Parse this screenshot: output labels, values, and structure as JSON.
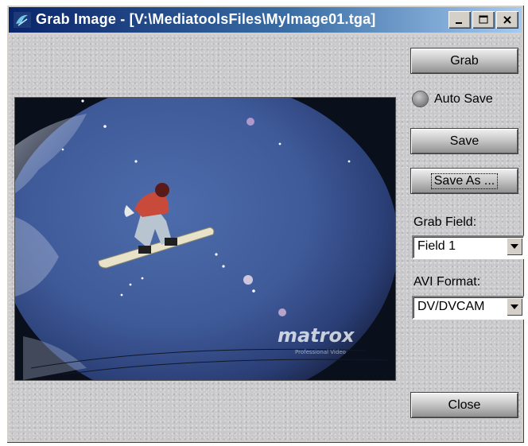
{
  "window": {
    "title": "Grab Image - [V:\\MediatoolsFiles\\MyImage01.tga]"
  },
  "titlebar_buttons": {
    "minimize": "minimize-icon",
    "maximize": "maximize-icon",
    "close": "close-icon"
  },
  "buttons": {
    "grab": "Grab",
    "save": "Save",
    "save_as": "Save As ...",
    "close": "Close"
  },
  "auto_save": {
    "label": "Auto Save",
    "checked": false
  },
  "grab_field": {
    "label": "Grab Field:",
    "value": "Field 1"
  },
  "avi_format": {
    "label": "AVI Format:",
    "value": "DV/DVCAM"
  },
  "preview": {
    "watermark": "matrox",
    "watermark_sub": "Professional Video",
    "sky_color": "#3f5a99"
  }
}
